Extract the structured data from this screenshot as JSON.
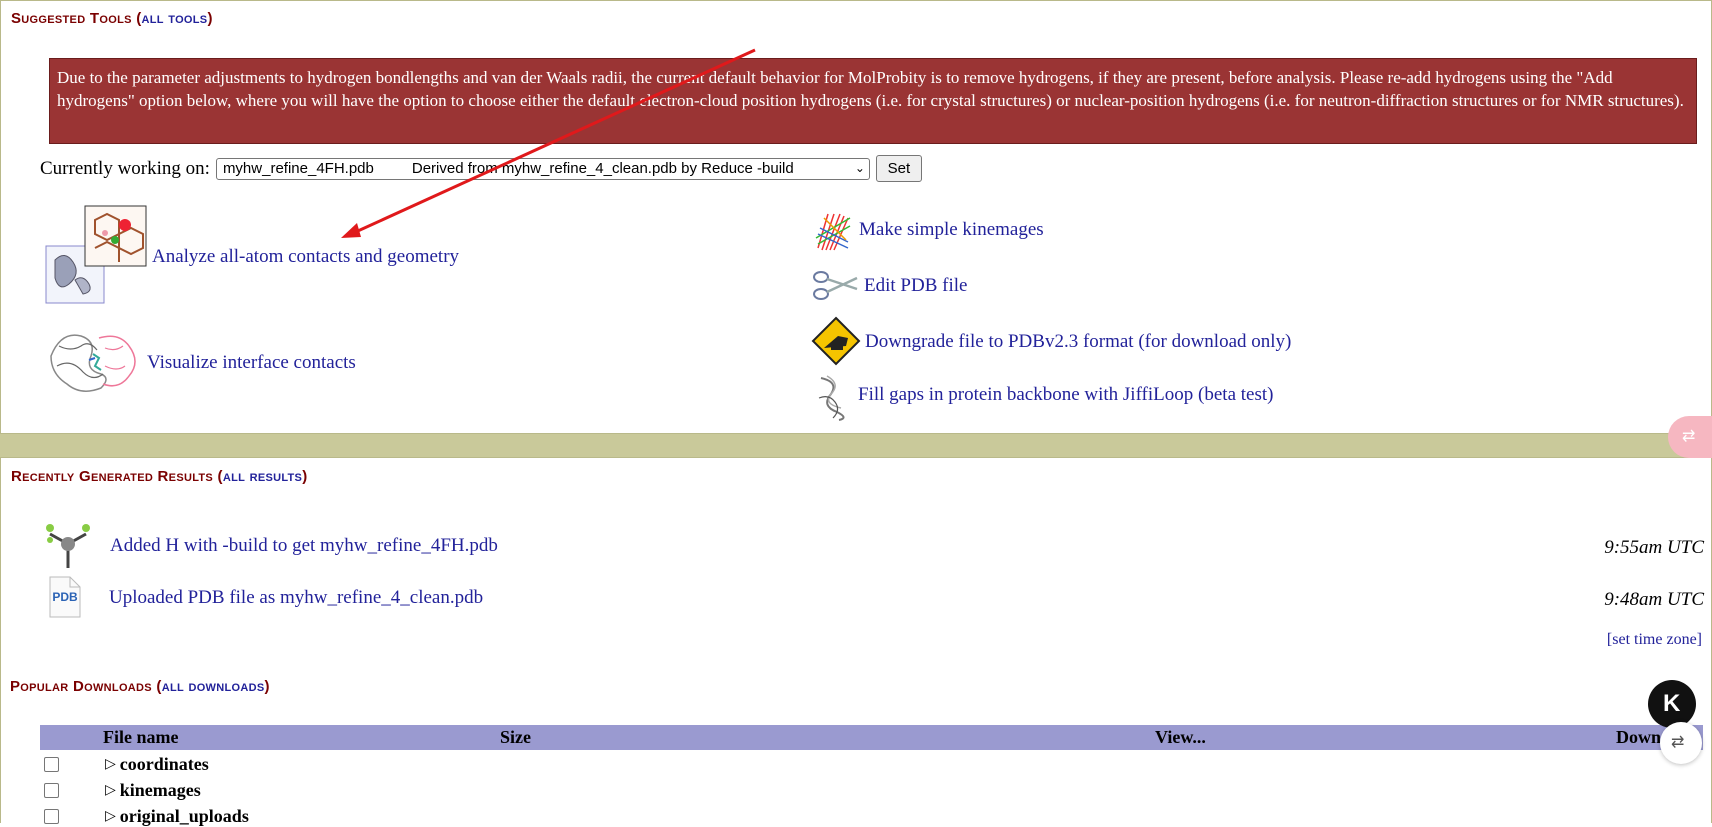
{
  "suggested_tools": {
    "title": "Suggested Tools",
    "link": "all tools",
    "warning": "Due to the parameter adjustments to hydrogen bondlengths and van der Waals radii, the current default behavior for MolProbity is to remove hydrogens, if they are present, before analysis. Please re-add hydrogens using the \"Add hydrogens\" option below, where you will have the option to choose either the default electron-cloud position hydrogens (i.e. for crystal structures) or nuclear-position hydrogens (i.e. for neutron-diffraction structures or for NMR structures).",
    "working_label": "Currently working on:",
    "working_file": "myhw_refine_4FH.pdb",
    "working_derived": "Derived from myhw_refine_4_clean.pdb by Reduce -build",
    "set_button": "Set",
    "tools_left": [
      {
        "label": "Analyze all-atom contacts and geometry",
        "icon": "contacts-geometry-icon"
      },
      {
        "label": "Visualize interface contacts",
        "icon": "interface-contacts-icon"
      }
    ],
    "tools_right": [
      {
        "label": "Make simple kinemages",
        "icon": "kinemage-icon"
      },
      {
        "label": "Edit PDB file",
        "icon": "scissors-icon"
      },
      {
        "label": "Downgrade file to PDBv2.3 format (for download only)",
        "icon": "downgrade-warning-icon"
      },
      {
        "label": "Fill gaps in protein backbone with JiffiLoop (beta test)",
        "icon": "backbone-loop-icon"
      }
    ]
  },
  "recent_results": {
    "title": "Recently Generated Results",
    "link": "all results",
    "items": [
      {
        "label": "Added H with -build to get myhw_refine_4FH.pdb",
        "time": "9:55am UTC",
        "icon": "hydrogen-molecule-icon"
      },
      {
        "label": "Uploaded PDB file as myhw_refine_4_clean.pdb",
        "time": "9:48am UTC",
        "icon": "pdb-file-icon"
      }
    ],
    "timezone_link": "[set time zone]"
  },
  "popular_downloads": {
    "title": "Popular Downloads",
    "link": "all downloads",
    "columns": [
      "File name",
      "Size",
      "View...",
      "Down"
    ],
    "rows": [
      "coordinates",
      "kinemages",
      "original_uploads"
    ]
  },
  "pdb_icon_text": "PDB",
  "colors": {
    "warning_bg": "#9a3434",
    "title": "#7a0000",
    "link": "#22229a",
    "table_head": "#9a9ad0",
    "band": "#c9c99a"
  }
}
